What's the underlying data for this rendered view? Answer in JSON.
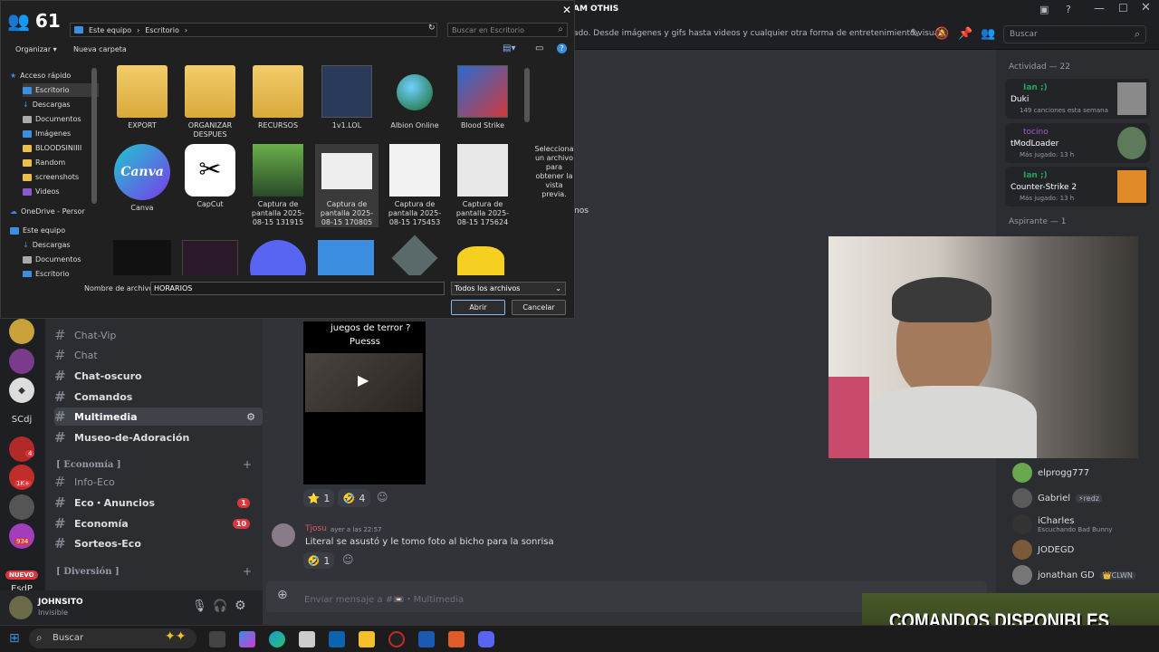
{
  "member_count_top": "61",
  "topbar": {
    "title": "AM OTHIS",
    "description": "ado. Desde imágenes y gifs hasta videos y cualquier otra forma de entretenimiento visua...",
    "search_placeholder": "Buscar"
  },
  "dialog": {
    "path": [
      "Este equipo",
      "Escritorio"
    ],
    "search_placeholder": "Buscar en Escritorio",
    "organize": "Organizar ▾",
    "new_folder": "Nueva carpeta",
    "nav": [
      {
        "label": "Acceso rápido",
        "kind": "star"
      },
      {
        "label": "Escritorio",
        "kind": "blue"
      },
      {
        "label": "Descargas",
        "kind": "dl"
      },
      {
        "label": "Documentos",
        "kind": "doc"
      },
      {
        "label": "Imágenes",
        "kind": "img"
      },
      {
        "label": "BLOODSINIIII",
        "kind": "folder"
      },
      {
        "label": "Random",
        "kind": "folder"
      },
      {
        "label": "screenshots",
        "kind": "folder"
      },
      {
        "label": "Videos",
        "kind": "vid"
      },
      {
        "label": "OneDrive - Persor",
        "kind": "cloud"
      },
      {
        "label": "Este equipo",
        "kind": "pc"
      },
      {
        "label": "Descargas",
        "kind": "dl"
      },
      {
        "label": "Documentos",
        "kind": "doc"
      },
      {
        "label": "Escritorio",
        "kind": "blue"
      }
    ],
    "files": [
      {
        "label": "EXPORT",
        "icon": "folder"
      },
      {
        "label": "ORGANIZAR DESPUES",
        "icon": "folder"
      },
      {
        "label": "RECURSOS",
        "icon": "folder"
      },
      {
        "label": "1v1.LOL",
        "icon": "game"
      },
      {
        "label": "Albion Online",
        "icon": "globe"
      },
      {
        "label": "Blood Strike",
        "icon": "game"
      },
      {
        "label": "Canva",
        "icon": "canva"
      },
      {
        "label": "CapCut",
        "icon": "capcut"
      },
      {
        "label": "Captura de pantalla 2025-08-15 131915",
        "icon": "shot"
      },
      {
        "label": "Captura de pantalla 2025-08-15 170805",
        "icon": "shot"
      },
      {
        "label": "Captura de pantalla 2025-08-15 175453",
        "icon": "shot"
      },
      {
        "label": "Captura de pantalla 2025-08-15 175624",
        "icon": "shot"
      }
    ],
    "canva_text": "Canva",
    "preview_text": "Selecciona un archivo para obtener la vista previa.",
    "filename_label": "Nombre de archivo:",
    "filename_value": "HORARIOS",
    "filetype": "Todos los archivos",
    "open": "Abrir",
    "cancel": "Cancelar"
  },
  "channels": [
    {
      "name": "Chat-Vip",
      "bold": false
    },
    {
      "name": "Chat",
      "bold": false
    },
    {
      "name": "Chat-oscuro",
      "bold": true
    },
    {
      "name": "Comandos",
      "bold": true
    },
    {
      "name": "Multimedia",
      "bold": true
    },
    {
      "name": "Museo-de-Adoración",
      "bold": true
    },
    {
      "name": "Info-Eco",
      "bold": false
    },
    {
      "name": "Eco・Anuncios",
      "bold": true
    },
    {
      "name": "Economía",
      "bold": true
    },
    {
      "name": "Sorteos-Eco",
      "bold": true
    }
  ],
  "categories": [
    "[ Economía ]",
    "[ Diversión ]"
  ],
  "badges": {
    "eco_anuncios": "1",
    "economia": "10"
  },
  "servers": {
    "scdj": "SCdj",
    "esdp": "EsdP",
    "nuevo": "NUEVO",
    "count934": "934",
    "k1": "1K+",
    "four": "4"
  },
  "user": {
    "name": "JOHNSITO",
    "status": "Invisible"
  },
  "messages": {
    "post_text_1": "juegos de terror ?",
    "post_text_2": "Puesss",
    "reaction1": "1",
    "reaction2": "4",
    "author": "Tjosu",
    "time": "ayer a las 22:57",
    "text": "Literal se asustó y le tomo foto al bicho para la sonrisa",
    "reaction3": "1",
    "partial": "nos",
    "input_placeholder": "Enviar mensaje a #📼・Multimedia"
  },
  "activity": {
    "header": "Actividad — 22",
    "cards": [
      {
        "user": "Ian ;)",
        "title": "Duki",
        "sub": "149 canciones esta semana"
      },
      {
        "user": "tocino",
        "title": "tModLoader",
        "sub": "Más jugado: 13 h"
      },
      {
        "user": "Ian ;)",
        "title": "Counter-Strike 2",
        "sub": "Más jugado: 13 h"
      }
    ],
    "aspirante": "Aspirante — 1"
  },
  "members": [
    {
      "name": "elprogg777",
      "sub": ""
    },
    {
      "name": "Gabriel",
      "sub": "",
      "tag": "⚡redz"
    },
    {
      "name": "iCharles",
      "sub": "Escuchando Bad Bunny"
    },
    {
      "name": "JODEGD",
      "sub": ""
    },
    {
      "name": "jonathan GD",
      "sub": "",
      "tag": "👑CLWN"
    }
  ],
  "overlay": "COMANDOS DISPONIBLES",
  "taskbar": {
    "search": "Buscar"
  },
  "colors": {
    "accent": "#5865f2",
    "mention": "#da373c",
    "green": "#23a55a",
    "dialog_bg": "#202020"
  }
}
